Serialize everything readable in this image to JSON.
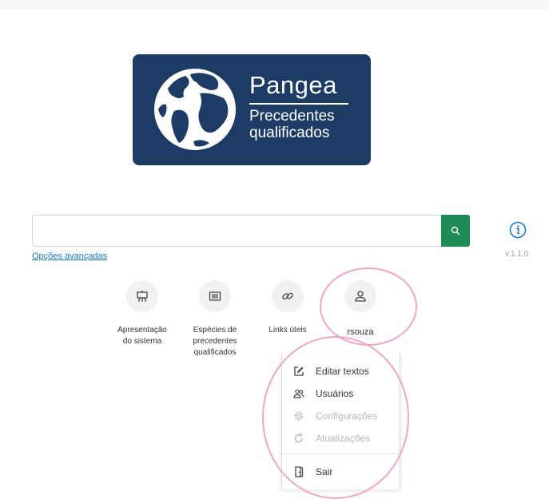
{
  "logo": {
    "title": "Pangea",
    "subtitle_line1": "Precedentes",
    "subtitle_line2": "qualificados",
    "icon": "globe-icon",
    "background_color": "#1c3c66"
  },
  "search": {
    "value": "",
    "placeholder": "",
    "button_icon": "search-icon",
    "button_color": "#208c55"
  },
  "advanced_link": "Opções avançadas",
  "version": "v.1.1.0",
  "info_icon": "info-icon",
  "tiles": [
    {
      "line1": "Apresentação",
      "line2": "do sistema",
      "line3": "",
      "icon": "easel-icon"
    },
    {
      "line1": "Espécies de",
      "line2": "precedentes",
      "line3": "qualificados",
      "icon": "list-icon"
    },
    {
      "line1": "Links úteis",
      "line2": "",
      "line3": "",
      "icon": "link-icon"
    },
    {
      "line1": "rsouza",
      "line2": "",
      "line3": "",
      "icon": "user-icon"
    }
  ],
  "user_menu": {
    "items": [
      {
        "label": "Editar textos",
        "icon": "edit-icon",
        "enabled": true
      },
      {
        "label": "Usuários",
        "icon": "users-icon",
        "enabled": true
      },
      {
        "label": "Configurações",
        "icon": "gear-icon",
        "enabled": false
      },
      {
        "label": "Atualizações",
        "icon": "refresh-icon",
        "enabled": false
      },
      {
        "label": "Sair",
        "icon": "logout-icon",
        "enabled": true
      }
    ]
  },
  "highlight_color": "#f0a4c6"
}
